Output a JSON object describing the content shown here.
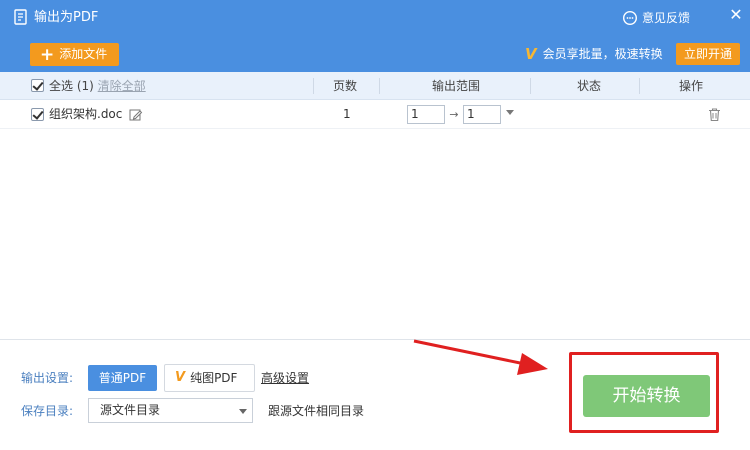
{
  "window": {
    "title": "输出为PDF",
    "feedback_label": "意见反馈",
    "close_icon": "close-icon",
    "accent": "#4a8fe0"
  },
  "toolbar": {
    "add_file_label": "添加文件",
    "vip_promo_text": "会员享批量，极速转换",
    "open_now_label": "立即开通",
    "button_color": "#f39a1e"
  },
  "table": {
    "headers": {
      "select_all": "全选",
      "selected_count": "(1)",
      "clear_all": "清除全部",
      "pages": "页数",
      "output_range": "输出范围",
      "status": "状态",
      "actions": "操作"
    },
    "rows": [
      {
        "checked": true,
        "filename": "组织架构.doc",
        "pages": "1",
        "range_from": "1",
        "range_to": "1",
        "status": ""
      }
    ]
  },
  "settings": {
    "output_label": "输出设置:",
    "normal_pdf_label": "普通PDF",
    "pure_pdf_label": "纯图PDF",
    "advanced_label": "高级设置",
    "save_dir_label": "保存目录:",
    "save_dir_value": "源文件目录",
    "save_dir_hint": "跟源文件相同目录"
  },
  "start": {
    "label": "开始转换",
    "color": "#7fc878"
  },
  "annotation": {
    "arrow_color": "#e02020"
  }
}
